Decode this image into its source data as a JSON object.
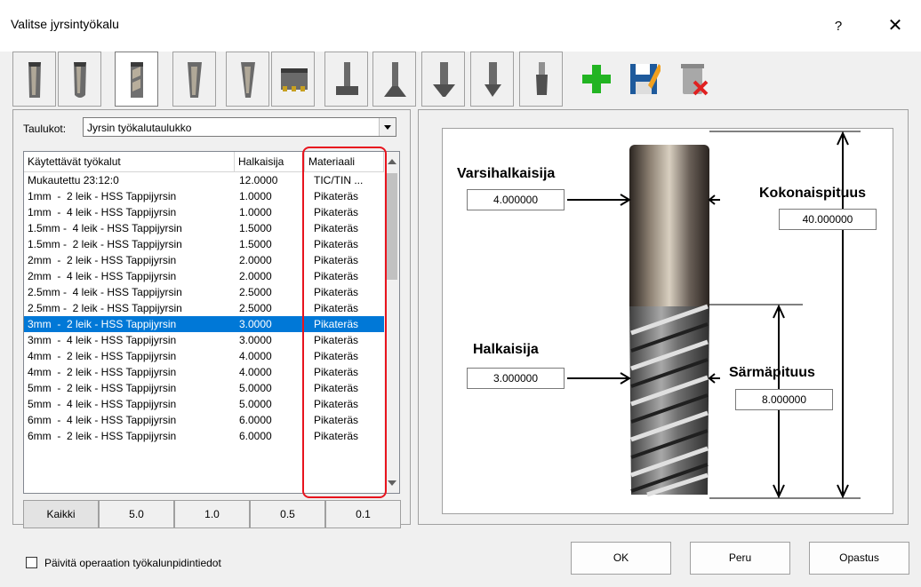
{
  "window": {
    "title": "Valitse jyrsintyökalu",
    "help": "?",
    "close": "✕"
  },
  "toolbar": {
    "tools": [
      {
        "icon": "flat-endmill-icon",
        "selected": false
      },
      {
        "icon": "ball-endmill-icon",
        "selected": false
      },
      {
        "icon": "endmill-icon",
        "selected": true
      },
      {
        "icon": "bull-endmill-icon",
        "selected": false
      },
      {
        "icon": "tapered-endmill-icon",
        "selected": false
      },
      {
        "icon": "face-mill-icon",
        "selected": false
      },
      {
        "icon": "t-slot-icon",
        "selected": false
      },
      {
        "icon": "dovetail-icon",
        "selected": false
      },
      {
        "icon": "chamfer-mill-icon",
        "selected": false
      },
      {
        "icon": "drill-icon",
        "selected": false
      },
      {
        "icon": "spot-drill-icon",
        "selected": false
      },
      {
        "icon": "tap-icon",
        "selected": false
      }
    ],
    "actions": [
      "add-tool-icon",
      "save-tool-icon",
      "delete-tool-icon"
    ]
  },
  "tables": {
    "label": "Taulukot:",
    "selected": "Jyrsin työkalutaulukko"
  },
  "list": {
    "columns": [
      "Käytettävät työkalut",
      "Halkaisija",
      "Materiaali"
    ],
    "rows": [
      {
        "name": "Mukautettu 23:12:0",
        "dia": "12.0000",
        "mat": "TIC/TIN ..."
      },
      {
        "name": "1mm  -  2 leik - HSS Tappijyrsin",
        "dia": "1.0000",
        "mat": "Pikateräs"
      },
      {
        "name": "1mm  -  4 leik - HSS Tappijyrsin",
        "dia": "1.0000",
        "mat": "Pikateräs"
      },
      {
        "name": "1.5mm -  4 leik - HSS Tappijyrsin",
        "dia": "1.5000",
        "mat": "Pikateräs"
      },
      {
        "name": "1.5mm -  2 leik - HSS Tappijyrsin",
        "dia": "1.5000",
        "mat": "Pikateräs"
      },
      {
        "name": "2mm  -  2 leik - HSS Tappijyrsin",
        "dia": "2.0000",
        "mat": "Pikateräs"
      },
      {
        "name": "2mm  -  4 leik - HSS Tappijyrsin",
        "dia": "2.0000",
        "mat": "Pikateräs"
      },
      {
        "name": "2.5mm -  4 leik - HSS Tappijyrsin",
        "dia": "2.5000",
        "mat": "Pikateräs"
      },
      {
        "name": "2.5mm -  2 leik - HSS Tappijyrsin",
        "dia": "2.5000",
        "mat": "Pikateräs"
      },
      {
        "name": "3mm  -  2 leik - HSS Tappijyrsin",
        "dia": "3.0000",
        "mat": "Pikateräs",
        "selected": true
      },
      {
        "name": "3mm  -  4 leik - HSS Tappijyrsin",
        "dia": "3.0000",
        "mat": "Pikateräs"
      },
      {
        "name": "4mm  -  2 leik - HSS Tappijyrsin",
        "dia": "4.0000",
        "mat": "Pikateräs"
      },
      {
        "name": "4mm  -  2 leik - HSS Tappijyrsin",
        "dia": "4.0000",
        "mat": "Pikateräs"
      },
      {
        "name": "5mm  -  2 leik - HSS Tappijyrsin",
        "dia": "5.0000",
        "mat": "Pikateräs"
      },
      {
        "name": "5mm  -  4 leik - HSS Tappijyrsin",
        "dia": "5.0000",
        "mat": "Pikateräs"
      },
      {
        "name": "6mm  -  4 leik - HSS Tappijyrsin",
        "dia": "6.0000",
        "mat": "Pikateräs"
      },
      {
        "name": "6mm  -  2 leik - HSS Tappijyrsin",
        "dia": "6.0000",
        "mat": "Pikateräs"
      }
    ]
  },
  "filters": {
    "items": [
      "Kaikki",
      "5.0",
      "1.0",
      "0.5",
      "0.1"
    ],
    "selected": "Kaikki"
  },
  "drawing": {
    "shank_label": "Varsihalkaisija",
    "shank_value": "4.000000",
    "total_label": "Kokonaispituus",
    "total_value": "40.000000",
    "diameter_label": "Halkaisija",
    "diameter_value": "3.000000",
    "flute_label": "Särmäpituus",
    "flute_value": "8.000000"
  },
  "footer": {
    "update_label": "Päivitä operaation työkalunpidintiedot",
    "update_checked": false,
    "ok": "OK",
    "cancel": "Peru",
    "help": "Opastus"
  },
  "colors": {
    "selection": "#0078d7",
    "highlight": "#e8141e",
    "add": "#22b422",
    "delete": "#e02020"
  }
}
